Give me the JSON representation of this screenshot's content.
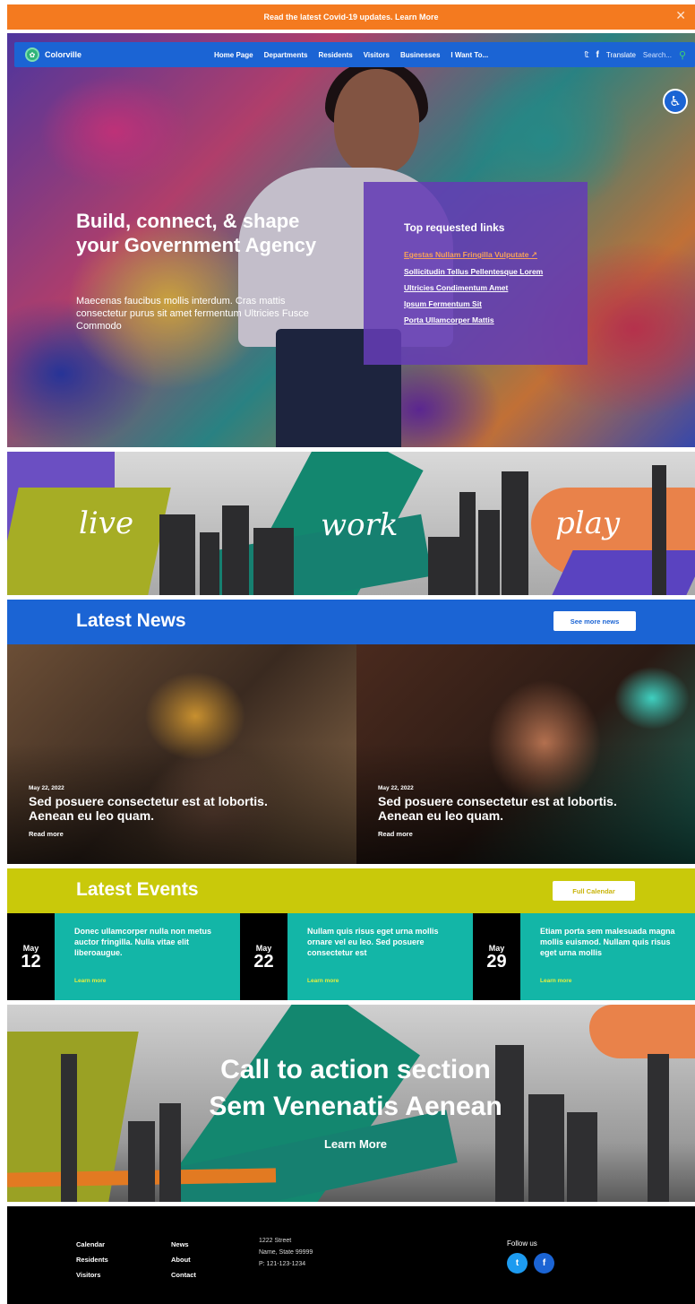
{
  "alert": {
    "text": "Read the latest Covid-19 updates. Learn More",
    "close": "✕"
  },
  "nav": {
    "logo_text": "Colorville",
    "links": [
      "Home Page",
      "Departments",
      "Residents",
      "Visitors",
      "Businesses",
      "I Want To..."
    ],
    "twitter": "𝕥",
    "facebook": "f",
    "translate": "Translate",
    "search_placeholder": "Search...",
    "search_icon": "⚲"
  },
  "hero": {
    "title": "Build, connect, & shape your Government Agency",
    "subtitle": "Maecenas faucibus mollis interdum. Cras mattis consectetur purus sit amet fermentum Ultricies Fusce Commodo",
    "accessibility_icon": "♿"
  },
  "top_links": {
    "title": "Top requested links",
    "items": [
      "Egestas Nullam Fringilla Vulputate ↗",
      "Sollicitudin Tellus Pellentesque Lorem",
      "Ultricies Condimentum Amet",
      "Ipsum Fermentum Sit",
      "Porta Ullamcorper Mattis"
    ]
  },
  "lwp": {
    "words": [
      "live",
      "work",
      "play"
    ]
  },
  "news": {
    "title": "Latest News",
    "button": "See more news",
    "items": [
      {
        "date": "May 22, 2022",
        "headline": "Sed posuere consectetur est at lobortis. Aenean eu leo quam.",
        "more": "Read more"
      },
      {
        "date": "May 22, 2022",
        "headline": "Sed posuere consectetur est at lobortis. Aenean eu leo quam.",
        "more": "Read more"
      }
    ]
  },
  "events": {
    "title": "Latest Events",
    "button": "Full Calendar",
    "items": [
      {
        "month": "May",
        "day": "12",
        "text": "Donec ullamcorper nulla non metus auctor fringilla. Nulla vitae elit liberoaugue.",
        "more": "Learn more"
      },
      {
        "month": "May",
        "day": "22",
        "text": "Nullam quis risus eget urna mollis ornare vel eu leo. Sed posuere consectetur est",
        "more": "Learn more"
      },
      {
        "month": "May",
        "day": "29",
        "text": "Etiam porta sem malesuada magna mollis euismod. Nullam quis risus eget urna mollis",
        "more": "Learn more"
      }
    ]
  },
  "cta": {
    "line1": "Call to action section",
    "line2": "Sem Venenatis Aenean",
    "link": "Learn More"
  },
  "footer": {
    "col1": [
      "Calendar",
      "Residents",
      "Visitors"
    ],
    "col2": [
      "News",
      "About",
      "Contact"
    ],
    "address": [
      "1222 Street",
      "Name, State 99999",
      "P: 121-123-1234"
    ],
    "follow": "Follow us",
    "twitter": "t",
    "facebook": "f"
  },
  "colors": {
    "nav_blue": "#1b64d4",
    "alert_orange": "#f47a1f",
    "events_yellow": "#c9c90a",
    "events_teal": "#13b6a7",
    "panel_purple": "#643cb4"
  }
}
